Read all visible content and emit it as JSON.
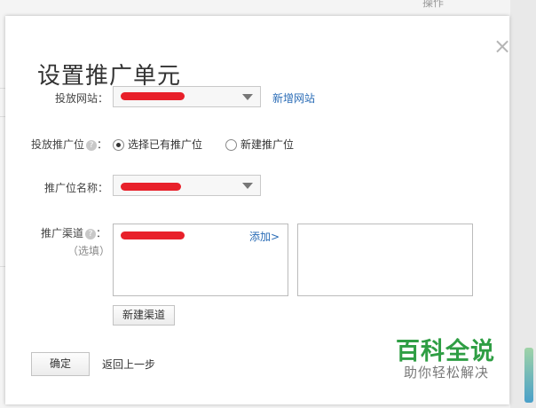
{
  "background": {
    "column_header": "操作"
  },
  "dialog": {
    "title": "设置推广单元",
    "close_glyph": "×",
    "website": {
      "label": "投放网站：",
      "add_link": "新增网站"
    },
    "slot": {
      "label": "投放推广位",
      "option_existing": "选择已有推广位",
      "option_new": "新建推广位",
      "selected": "existing"
    },
    "slot_name": {
      "label": "推广位名称："
    },
    "channel": {
      "label": "推广渠道",
      "label_colon": "：",
      "optional": "（选填）",
      "add_link": "添加>",
      "new_button": "新建渠道"
    },
    "footer": {
      "confirm": "确定",
      "back": "返回上一步"
    }
  },
  "watermark": {
    "title": "百科全说",
    "subtitle": "助你轻松解决"
  },
  "colors": {
    "redaction": "#e8202a",
    "link": "#2a6cb6",
    "watermark_green": "#2f9e44"
  }
}
